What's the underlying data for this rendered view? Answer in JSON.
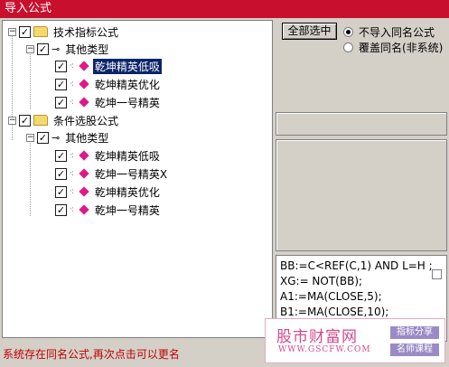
{
  "window": {
    "title": "导入公式"
  },
  "tree": {
    "groups": [
      {
        "label": "技术指标公式",
        "subgroup": "其他类型",
        "items": [
          "乾坤精英低吸",
          "乾坤精英优化",
          "乾坤一号精英"
        ]
      },
      {
        "label": "条件选股公式",
        "subgroup": "其他类型",
        "items": [
          "乾坤精英低吸",
          "乾坤一号精英X",
          "乾坤精英优化",
          "乾坤一号精英"
        ]
      }
    ],
    "selected_item": "乾坤精英低吸"
  },
  "controls": {
    "select_all_label": "全部选中",
    "radio_options": [
      {
        "label": "不导入同名公式",
        "selected": true
      },
      {
        "label": "覆盖同名(非系统)",
        "selected": false
      }
    ]
  },
  "code_lines": [
    "BB:=C<REF(C,1) AND L=H ;",
    "XG:= NOT(BB);",
    "A1:=MA(CLOSE,5);",
    "B1:=MA(CLOSE,10);"
  ],
  "status_text": "系统存在同名公式,再次点击可以更名",
  "watermark": {
    "main": "股市财富网",
    "url": "WWW.GSCFW.COM",
    "tag1": "指标分享",
    "tag2": "名师课程"
  },
  "colors": {
    "title_bar": "#c8102e",
    "selection": "#0a246a",
    "status": "#c00000",
    "gem": "#e0188a"
  },
  "icons": {
    "group": "folder-icon",
    "subgroup": "key-icon",
    "item": "formula-gem-icon"
  }
}
